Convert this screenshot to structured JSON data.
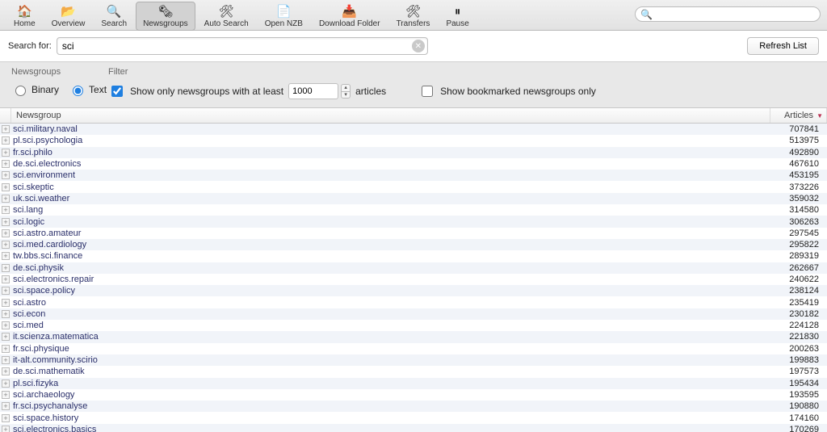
{
  "toolbar": {
    "items": [
      {
        "label": "Home",
        "icon": "🏠"
      },
      {
        "label": "Overview",
        "icon": "📂"
      },
      {
        "label": "Search",
        "icon": "🔍"
      },
      {
        "label": "Newsgroups",
        "icon": "🗞",
        "active": true
      },
      {
        "label": "Auto Search",
        "icon": "🛠"
      },
      {
        "label": "Open NZB",
        "icon": "📄"
      },
      {
        "label": "Download Folder",
        "icon": "📥"
      },
      {
        "label": "Transfers",
        "icon": "🛠"
      },
      {
        "label": "Pause",
        "icon": "⏸"
      }
    ],
    "search_placeholder": ""
  },
  "searchbar": {
    "label": "Search for:",
    "value": "sci",
    "refresh_label": "Refresh List"
  },
  "filter": {
    "groups_heading": "Newsgroups",
    "filter_heading": "Filter",
    "binary_label": "Binary",
    "text_label": "Text",
    "mode": "text",
    "atleast_checked": true,
    "atleast_prefix": "Show only newsgroups with at least",
    "atleast_value": "1000",
    "atleast_suffix": "articles",
    "bookmarked_checked": false,
    "bookmarked_label": "Show bookmarked newsgroups only"
  },
  "table": {
    "col_plus": "",
    "col_name": "Newsgroup",
    "col_articles": "Articles",
    "rows": [
      {
        "name": "sci.military.naval",
        "articles": "707841"
      },
      {
        "name": "pl.sci.psychologia",
        "articles": "513975"
      },
      {
        "name": "fr.sci.philo",
        "articles": "492890"
      },
      {
        "name": "de.sci.electronics",
        "articles": "467610"
      },
      {
        "name": "sci.environment",
        "articles": "453195"
      },
      {
        "name": "sci.skeptic",
        "articles": "373226"
      },
      {
        "name": "uk.sci.weather",
        "articles": "359032"
      },
      {
        "name": "sci.lang",
        "articles": "314580"
      },
      {
        "name": "sci.logic",
        "articles": "306263"
      },
      {
        "name": "sci.astro.amateur",
        "articles": "297545"
      },
      {
        "name": "sci.med.cardiology",
        "articles": "295822"
      },
      {
        "name": "tw.bbs.sci.finance",
        "articles": "289319"
      },
      {
        "name": "de.sci.physik",
        "articles": "262667"
      },
      {
        "name": "sci.electronics.repair",
        "articles": "240622"
      },
      {
        "name": "sci.space.policy",
        "articles": "238124"
      },
      {
        "name": "sci.astro",
        "articles": "235419"
      },
      {
        "name": "sci.econ",
        "articles": "230182"
      },
      {
        "name": "sci.med",
        "articles": "224128"
      },
      {
        "name": "it.scienza.matematica",
        "articles": "221830"
      },
      {
        "name": "fr.sci.physique",
        "articles": "200263"
      },
      {
        "name": "it-alt.community.scirio",
        "articles": "199883"
      },
      {
        "name": "de.sci.mathematik",
        "articles": "197573"
      },
      {
        "name": "pl.sci.fizyka",
        "articles": "195434"
      },
      {
        "name": "sci.archaeology",
        "articles": "193595"
      },
      {
        "name": "fr.sci.psychanalyse",
        "articles": "190880"
      },
      {
        "name": "sci.space.history",
        "articles": "174160"
      },
      {
        "name": "sci.electronics.basics",
        "articles": "170269"
      }
    ]
  }
}
